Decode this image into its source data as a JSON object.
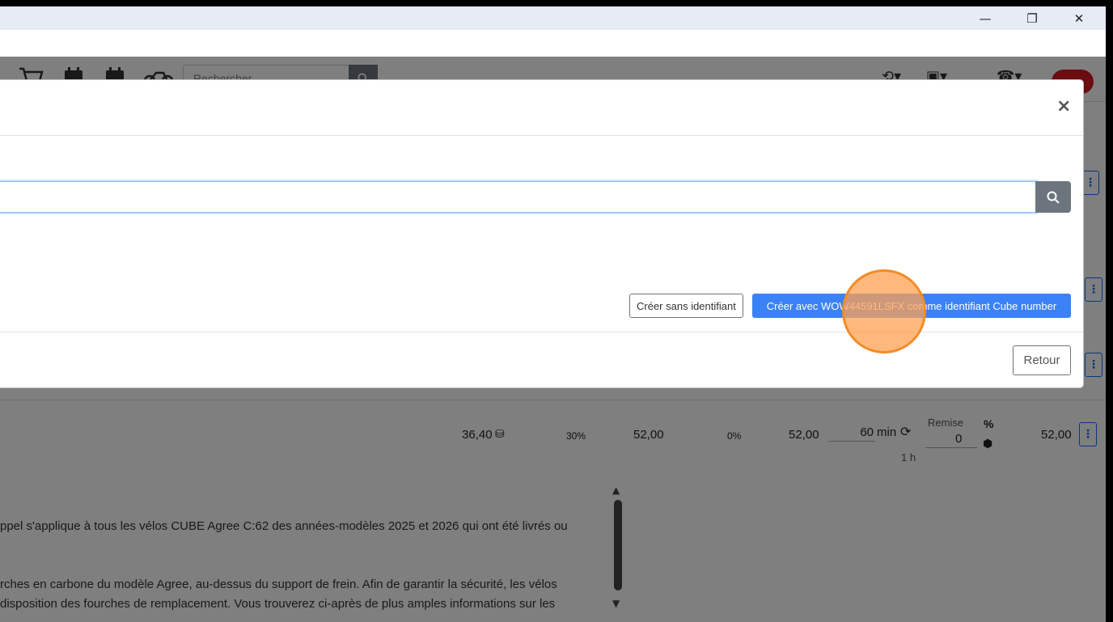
{
  "window": {
    "minimize_icon": "minimize-icon",
    "maximize_icon": "restore-icon",
    "close_icon": "close-icon",
    "minimize_glyph": "—",
    "maximize_glyph": "❐",
    "close_glyph": "✕"
  },
  "navbar": {
    "search_placeholder": "Rechercher",
    "history_glyph": "⟲▾",
    "devices_glyph": "▣▾",
    "phone_glyph": "☎▾"
  },
  "modal": {
    "close_label": "×",
    "search_value": "",
    "create_without_id_label": "Créer sans identifiant",
    "create_with_id_label": "Créer avec WOW44591LSFX comme identifiant Cube number",
    "back_label": "Retour"
  },
  "background_row": {
    "cost": "36,40",
    "margin_pct": "30%",
    "price": "52,00",
    "vat_pct": "0%",
    "price2": "52,00",
    "duration_value": "60",
    "duration_unit": "min",
    "duration_hours": "1 h",
    "discount_label": "Remise",
    "discount_value": "0",
    "total": "52,00",
    "percent_glyph": "%"
  },
  "background_text": {
    "line1": "ppel s'applique à tous les vélos CUBE Agree C:62 des années-modèles 2025 et 2026 qui ont été livrés ou",
    "line2": "rches en carbone du modèle Agree, au-dessus du support de frein. Afin de garantir la sécurité, les vélos",
    "line3": "disposition des fourches de remplacement. Vous trouverez ci-après de plus amples informations sur les"
  },
  "colors": {
    "primary": "#3b82f6",
    "secondary": "#6c757d",
    "click_marker": "#f28c28"
  }
}
